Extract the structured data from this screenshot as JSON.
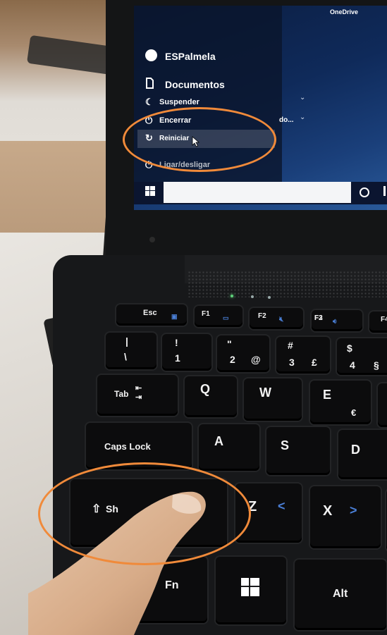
{
  "screen": {
    "onedrive_label": "OneDrive",
    "user_name": "ESPalmela",
    "documents_label": "Documentos",
    "power_options": [
      {
        "label": "Suspender",
        "icon": "moon-icon"
      },
      {
        "label": "Encerrar",
        "icon": "power-icon"
      },
      {
        "label": "Reiniciar",
        "icon": "restart-icon"
      }
    ],
    "partial_item": "Ligar/desligar",
    "truncated_text": "do...",
    "selected_option": "Reiniciar"
  },
  "keyboard": {
    "fkeys": [
      {
        "label": "Esc"
      },
      {
        "label": "F1"
      },
      {
        "label": "F2"
      },
      {
        "label": "F3"
      },
      {
        "label": "F4"
      }
    ],
    "number_row": [
      {
        "top": "|",
        "bottom": "\\"
      },
      {
        "top": "!",
        "bottom": "1"
      },
      {
        "top": "\"",
        "bottom": "2",
        "alt": "@"
      },
      {
        "top": "#",
        "bottom": "3",
        "alt": "£"
      },
      {
        "top": "$",
        "bottom": "4",
        "alt": "§"
      }
    ],
    "tab_label": "Tab",
    "q_label": "Q",
    "w_label": "W",
    "e_label": "E",
    "euro_label": "€",
    "caps_label": "Caps Lock",
    "a_label": "A",
    "s_label": "S",
    "d_label": "D",
    "shift_label": "Sh",
    "z_label": "Z",
    "z_alt": "<",
    "x_label": "X",
    "x_alt": ">",
    "fn_label": "Fn",
    "alt_label": "Alt"
  },
  "annotation_color": "#f08a3a",
  "icons": [
    "onedrive-icon",
    "user-avatar-icon",
    "document-icon",
    "moon-icon",
    "power-icon",
    "restart-icon",
    "mouse-cursor-icon",
    "windows-start-icon",
    "cortana-icon",
    "windows-key-icon",
    "shift-arrow-icon",
    "tab-arrows-icon"
  ]
}
